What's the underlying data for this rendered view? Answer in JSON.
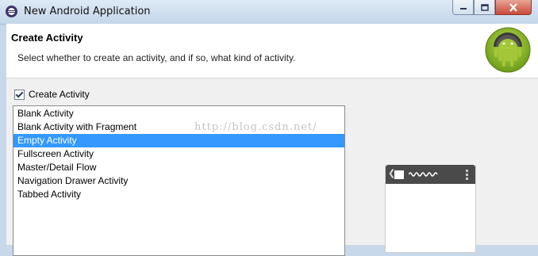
{
  "window": {
    "title": "New Android Application",
    "icon": "eclipse-icon"
  },
  "header": {
    "title": "Create Activity",
    "description": "Select whether to create an activity, and if so, what kind of activity.",
    "logo": "android-logo-icon"
  },
  "create_activity_checkbox": {
    "label": "Create Activity",
    "checked": true
  },
  "activity_list": {
    "items": [
      {
        "label": "Blank Activity",
        "selected": false
      },
      {
        "label": "Blank Activity with Fragment",
        "selected": false
      },
      {
        "label": "Empty Activity",
        "selected": true
      },
      {
        "label": "Fullscreen Activity",
        "selected": false
      },
      {
        "label": "Master/Detail Flow",
        "selected": false
      },
      {
        "label": "Navigation Drawer Activity",
        "selected": false
      },
      {
        "label": "Tabbed Activity",
        "selected": false
      }
    ]
  },
  "watermark": "http://blog.csdn.net/",
  "colors": {
    "selection": "#3399ff",
    "titlebar": "#c4d6ea",
    "close_button": "#c8493a"
  }
}
